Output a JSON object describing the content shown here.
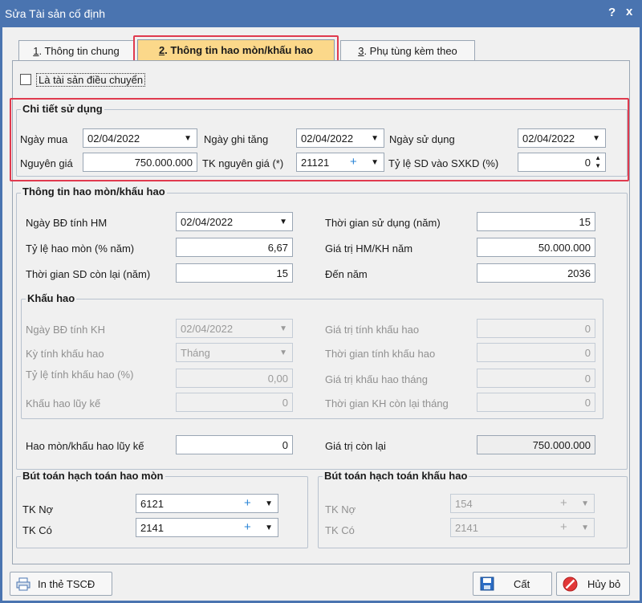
{
  "window": {
    "title": "Sửa Tài sản cố định",
    "help": "?",
    "close": "x"
  },
  "tabs": [
    {
      "num": "1",
      "label": ". Thông tin chung"
    },
    {
      "num": "2",
      "label": ". Thông tin hao mòn/khấu hao"
    },
    {
      "num": "3",
      "label": ". Phụ tùng kèm theo"
    }
  ],
  "transfer_checkbox": {
    "label": "Là tài sản điều chuyển",
    "checked": false
  },
  "usage": {
    "title": "Chi tiết sử dụng",
    "purchase_date": {
      "label": "Ngày mua",
      "value": "02/04/2022"
    },
    "increase_date": {
      "label": "Ngày ghi tăng",
      "value": "02/04/2022"
    },
    "use_date": {
      "label": "Ngày sử dụng",
      "value": "02/04/2022"
    },
    "original_cost": {
      "label": "Nguyên giá",
      "value": "750.000.000"
    },
    "cost_account": {
      "label": "TK nguyên giá (*)",
      "value": "21121",
      "plus": "+"
    },
    "business_rate": {
      "label": "Tỷ lệ SD vào SXKD (%)",
      "value": "0"
    }
  },
  "depreciation": {
    "title": "Thông tin hao mòn/khấu hao",
    "start_date": {
      "label": "Ngày BĐ tính HM",
      "value": "02/04/2022"
    },
    "rate": {
      "label": "Tỷ lệ hao mòn (% năm)",
      "value": "6,67"
    },
    "remaining_years": {
      "label": "Thời gian SD còn lại (năm)",
      "value": "15"
    },
    "useful_life": {
      "label": "Thời gian sử dụng (năm)",
      "value": "15"
    },
    "annual_value": {
      "label": "Giá trị HM/KH năm",
      "value": "50.000.000"
    },
    "end_year": {
      "label": "Đến năm",
      "value": "2036"
    }
  },
  "amortization": {
    "title": "Khấu hao",
    "start_date": {
      "label": "Ngày BĐ tính KH",
      "value": "02/04/2022"
    },
    "period": {
      "label": "Kỳ tính khấu hao",
      "value": "Tháng"
    },
    "rate": {
      "label": "Tỷ lệ tính khấu hao (%)",
      "value": "0,00"
    },
    "accumulated": {
      "label": "Khấu hao lũy kế",
      "value": "0"
    },
    "base_value": {
      "label": "Giá trị tính khấu hao",
      "value": "0"
    },
    "duration": {
      "label": "Thời gian tính khấu hao",
      "value": "0"
    },
    "monthly_value": {
      "label": "Giá trị khấu hao tháng",
      "value": "0"
    },
    "remaining_months": {
      "label": "Thời gian KH còn lại tháng",
      "value": "0"
    }
  },
  "totals": {
    "accumulated": {
      "label": "Hao mòn/khấu hao lũy kế",
      "value": "0"
    },
    "remaining_value": {
      "label": "Giá trị còn lại",
      "value": "750.000.000"
    }
  },
  "wear_entries": {
    "title": "Bút toán hạch toán hao mòn",
    "debit": {
      "label": "TK Nợ",
      "value": "6121",
      "plus": "+"
    },
    "credit": {
      "label": "TK Có",
      "value": "2141",
      "plus": "+"
    }
  },
  "amort_entries": {
    "title": "Bút toán hạch toán khấu hao",
    "debit": {
      "label": "TK Nợ",
      "value": "154",
      "plus": "+"
    },
    "credit": {
      "label": "TK Có",
      "value": "2141",
      "plus": "+"
    }
  },
  "footer": {
    "print": "In thẻ TSCĐ",
    "save": "Cất",
    "cancel": "Hủy bỏ"
  },
  "colors": {
    "title_bar": "#4a74b0",
    "active_tab": "#fbd88a",
    "highlight": "#e03a4e",
    "plus": "#2a84d6"
  }
}
